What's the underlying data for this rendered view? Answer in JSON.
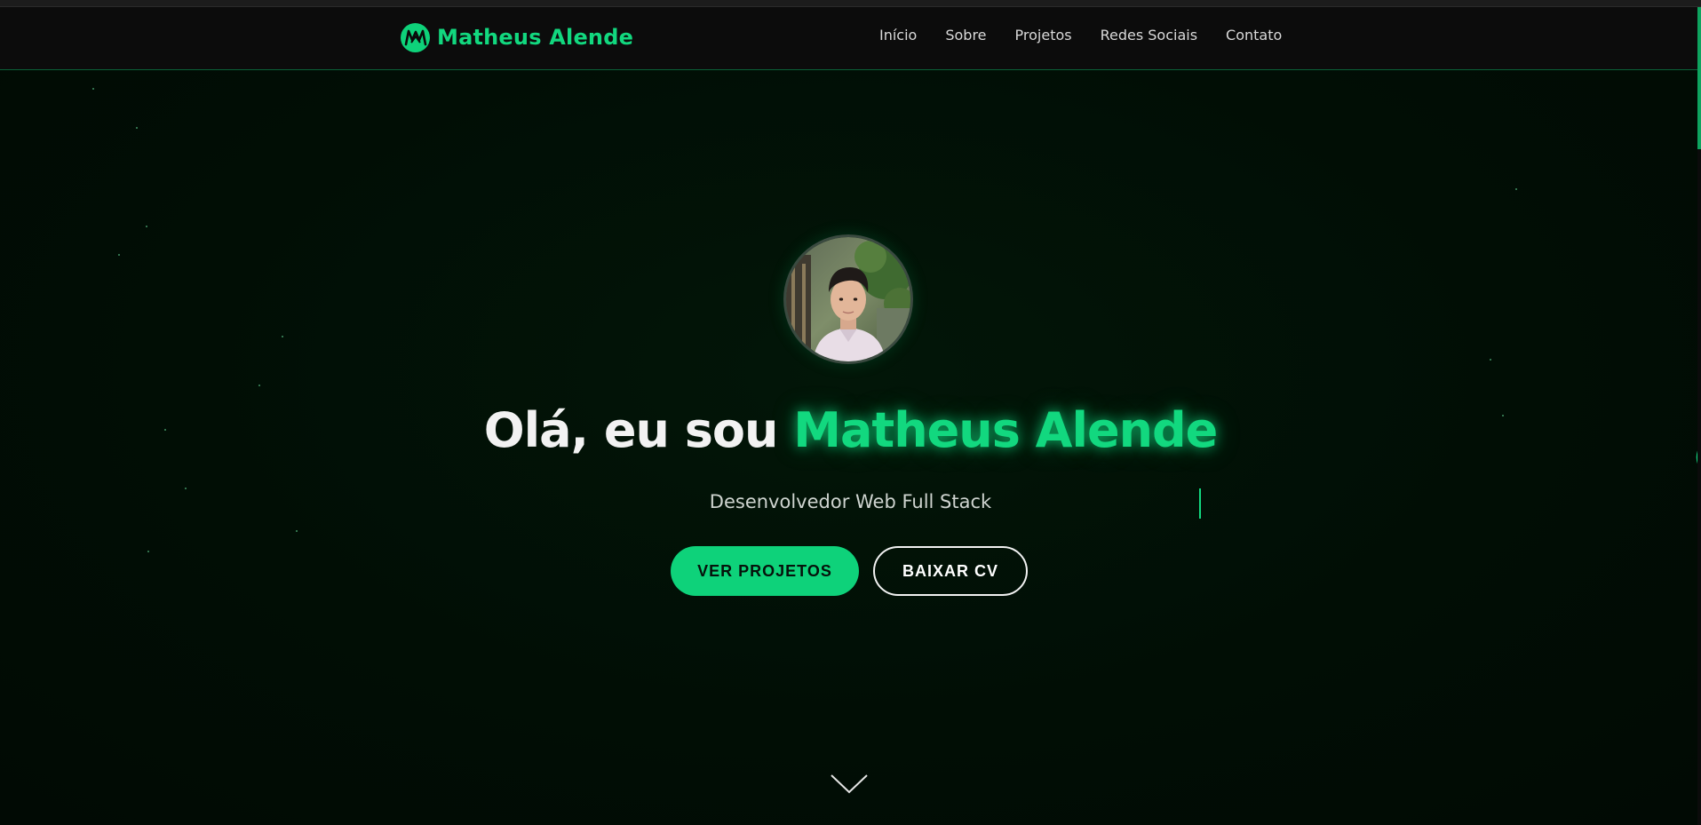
{
  "header": {
    "brand_name": "Matheus Alende",
    "logo_icon": "m-logo-icon",
    "nav": [
      {
        "label": "Início"
      },
      {
        "label": "Sobre"
      },
      {
        "label": "Projetos"
      },
      {
        "label": "Redes Sociais"
      },
      {
        "label": "Contato"
      }
    ]
  },
  "hero": {
    "greeting": "Olá, eu sou ",
    "name": "Matheus Alende",
    "subtitle": "Desenvolvedor Web Full Stack",
    "primary_button": "VER PROJETOS",
    "secondary_button": "BAIXAR CV",
    "scroll_icon": "chevron-down-icon"
  },
  "colors": {
    "accent": "#12d87f",
    "background": "#010d05",
    "navbar": "#0c0c0c",
    "text": "#f2f2f2"
  }
}
